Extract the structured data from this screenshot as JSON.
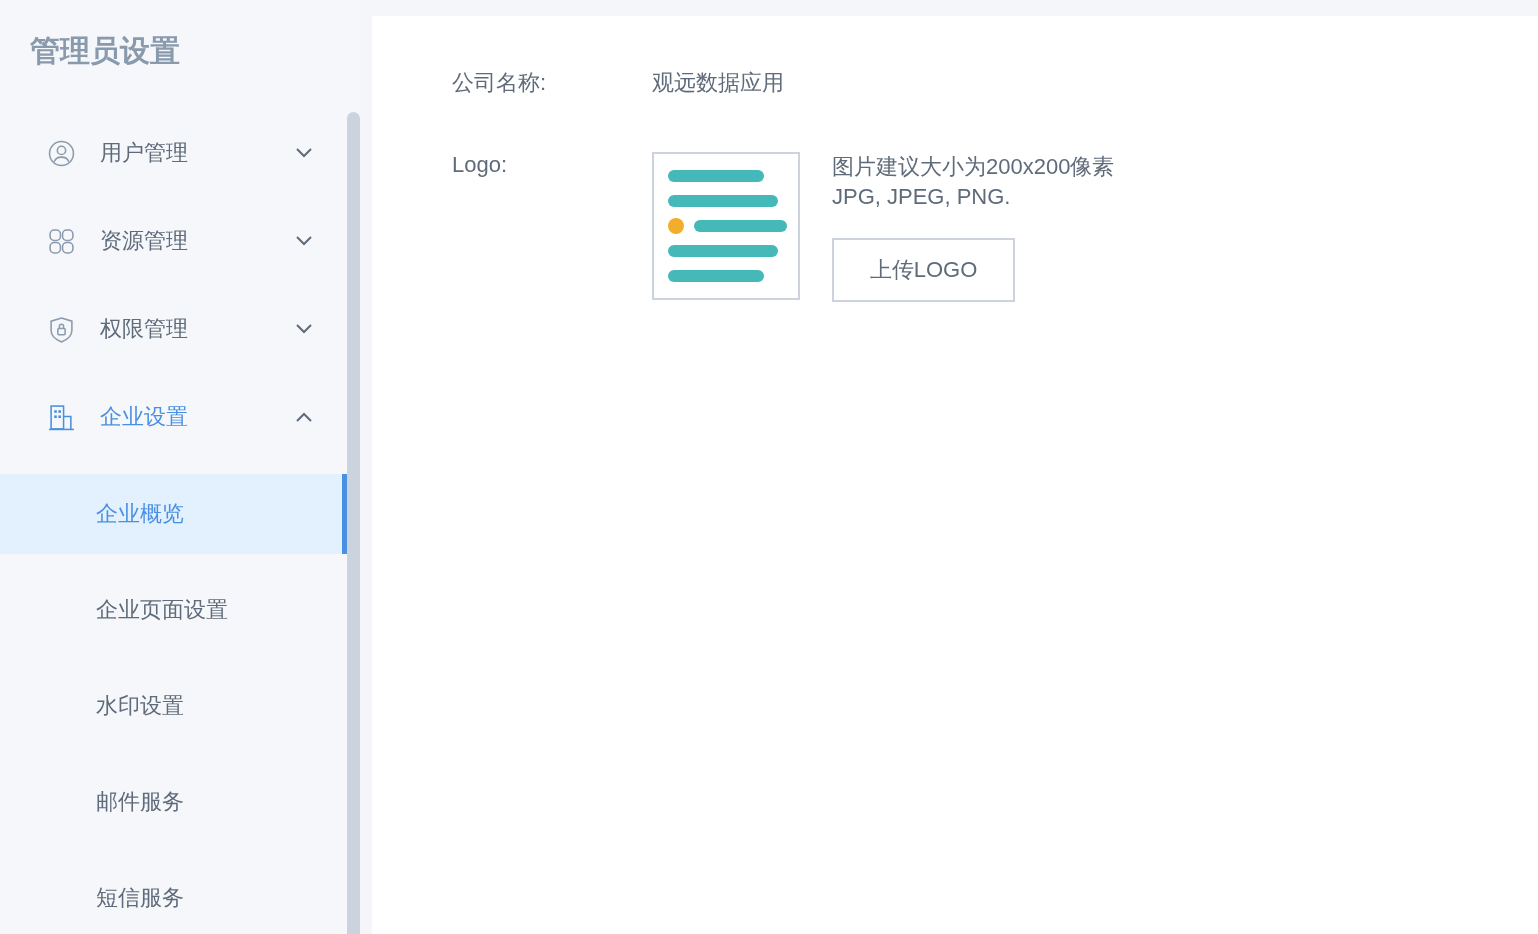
{
  "sidebar": {
    "title": "管理员设置",
    "groups": [
      {
        "label": "用户管理",
        "expanded": false
      },
      {
        "label": "资源管理",
        "expanded": false
      },
      {
        "label": "权限管理",
        "expanded": false
      },
      {
        "label": "企业设置",
        "expanded": true,
        "children": [
          {
            "label": "企业概览",
            "selected": true
          },
          {
            "label": "企业页面设置",
            "selected": false
          },
          {
            "label": "水印设置",
            "selected": false
          },
          {
            "label": "邮件服务",
            "selected": false
          },
          {
            "label": "短信服务",
            "selected": false
          }
        ]
      }
    ]
  },
  "form": {
    "company_label": "公司名称:",
    "company_value": "观远数据应用",
    "logo_label": "Logo:",
    "logo_hint": "图片建议大小为200x200像素",
    "logo_formats": "JPG, JPEG, PNG.",
    "upload_button": "上传LOGO"
  }
}
